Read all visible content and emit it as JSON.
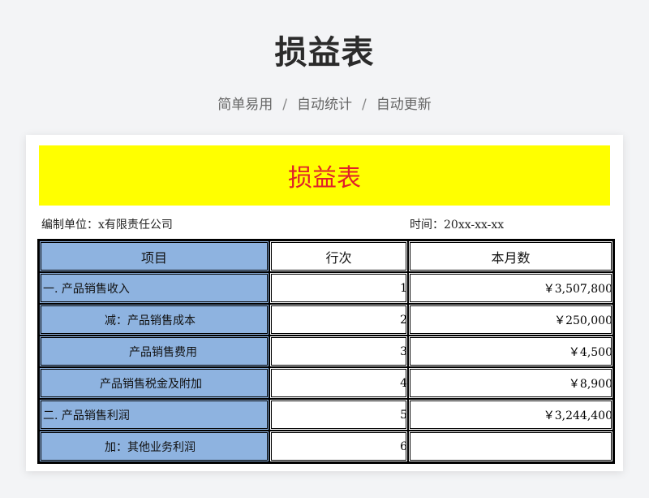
{
  "header": {
    "title": "损益表",
    "tags": [
      "简单易用",
      "自动统计",
      "自动更新"
    ],
    "separator": "/"
  },
  "sheet": {
    "title": "损益表",
    "company_label": "编制单位：x有限责任公司",
    "time_label": "时间：20xx-xx-xx",
    "columns": [
      "项目",
      "行次",
      "本月数"
    ],
    "rows": [
      {
        "item": "一. 产品销售收入",
        "seq": "1",
        "amount": "￥3,507,800"
      },
      {
        "item": "减：产品销售成本",
        "seq": "2",
        "amount": "￥250,000"
      },
      {
        "item": "产品销售费用",
        "seq": "3",
        "amount": "￥4,500"
      },
      {
        "item": "产品销售税金及附加",
        "seq": "4",
        "amount": "￥8,900"
      },
      {
        "item": "二. 产品销售利润",
        "seq": "5",
        "amount": "￥3,244,400"
      },
      {
        "item": "加：其他业务利润",
        "seq": "6",
        "amount": ""
      }
    ]
  },
  "colors": {
    "title_bg": "#ffff00",
    "title_text": "#e0202a",
    "item_col_bg": "#8eb3e0"
  }
}
